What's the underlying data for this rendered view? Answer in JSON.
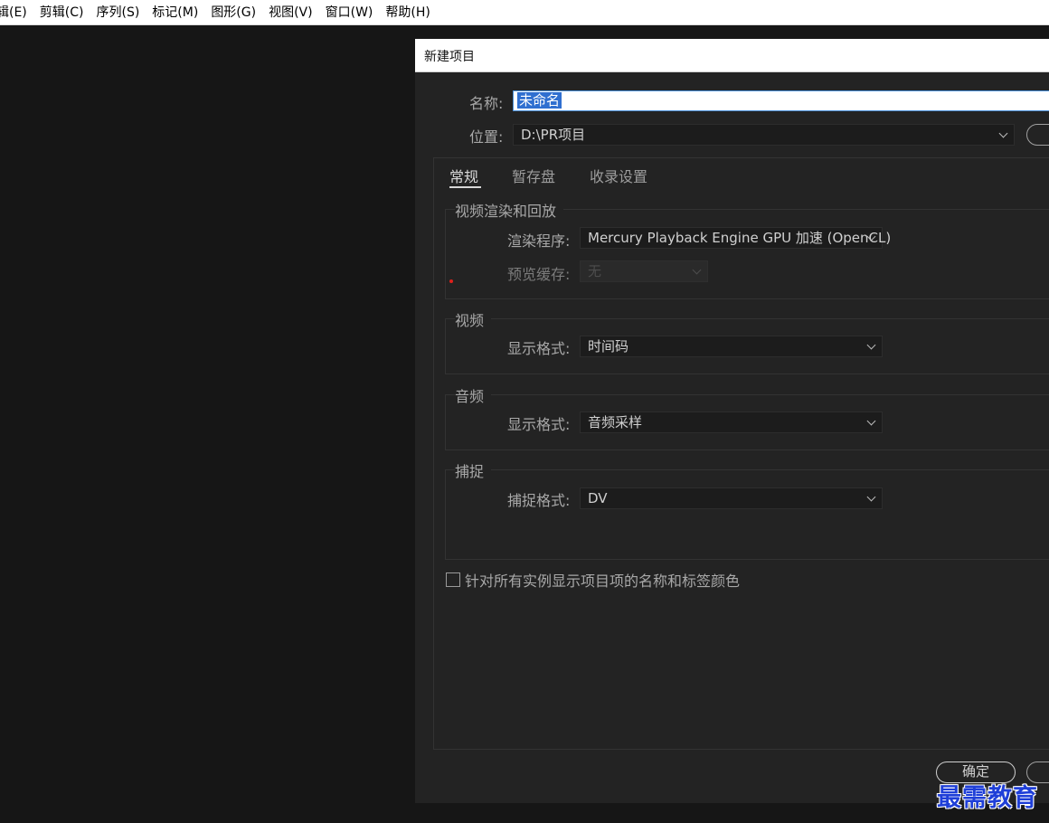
{
  "menubar": {
    "items": [
      "辑(E)",
      "剪辑(C)",
      "序列(S)",
      "标记(M)",
      "图形(G)",
      "视图(V)",
      "窗口(W)",
      "帮助(H)"
    ]
  },
  "dialog": {
    "title": "新建项目",
    "name_label": "名称:",
    "name_value": "未命名",
    "location_label": "位置:",
    "location_value": "D:\\PR项目",
    "tabs": [
      "常规",
      "暂存盘",
      "收录设置"
    ],
    "active_tab": "常规",
    "video_rendering": {
      "title": "视频渲染和回放",
      "renderer_label": "渲染程序:",
      "renderer_value": "Mercury Playback Engine GPU 加速 (OpenCL)",
      "preview_cache_label": "预览缓存:",
      "preview_cache_value": "无"
    },
    "video": {
      "title": "视频",
      "display_format_label": "显示格式:",
      "display_format_value": "时间码"
    },
    "audio": {
      "title": "音频",
      "display_format_label": "显示格式:",
      "display_format_value": "音频采样"
    },
    "capture": {
      "title": "捕捉",
      "capture_format_label": "捕捉格式:",
      "capture_format_value": "DV"
    },
    "checkbox_label": "针对所有实例显示项目项的名称和标签颜色",
    "checkbox_checked": false,
    "ok_label": "确定"
  },
  "watermark": "最需教育",
  "colors": {
    "dialog_bg": "#232323",
    "selection": "#2f6fd0",
    "watermark": "#1f3fd8"
  }
}
